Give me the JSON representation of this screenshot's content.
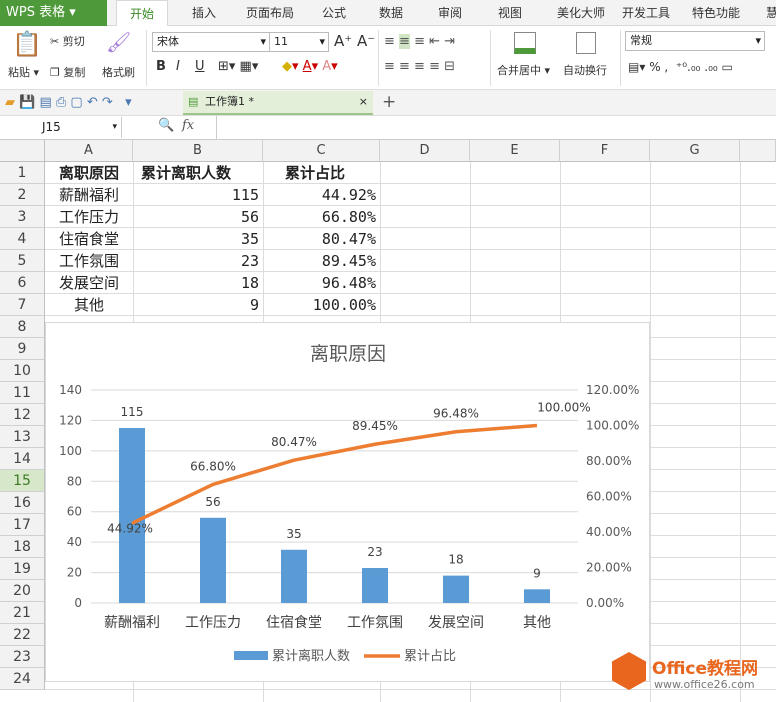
{
  "app": {
    "logo": "WPS 表格",
    "tabs": [
      "开始",
      "插入",
      "页面布局",
      "公式",
      "数据",
      "审阅",
      "视图",
      "美化大师",
      "开发工具",
      "特色功能",
      "慧"
    ]
  },
  "ribbon": {
    "paste": "粘贴",
    "cut": "剪切",
    "copy": "复制",
    "format_painter": "格式刷",
    "font_name": "宋体",
    "font_size": "11",
    "bold": "B",
    "italic": "I",
    "underline": "U",
    "merge_center": "合并居中",
    "wrap_text": "自动换行",
    "number_format": "常规",
    "percent": "%",
    "comma": ","
  },
  "quick": {
    "doc_tab": "工作簿1 *"
  },
  "formula_bar": {
    "name_box": "J15",
    "fx": "fx",
    "value": ""
  },
  "sheet": {
    "columns": [
      "A",
      "B",
      "C",
      "D",
      "E",
      "F",
      "G"
    ],
    "rows": [
      "1",
      "2",
      "3",
      "4",
      "5",
      "6",
      "7",
      "8",
      "9",
      "10",
      "11",
      "12",
      "13",
      "14",
      "15",
      "16",
      "17",
      "18",
      "19",
      "20",
      "21",
      "22",
      "23",
      "24"
    ],
    "selected_row": "15",
    "headers": [
      "离职原因",
      "累计离职人数",
      "累计占比"
    ],
    "data": [
      [
        "薪酬福利",
        "115",
        "44.92%"
      ],
      [
        "工作压力",
        "56",
        "66.80%"
      ],
      [
        "住宿食堂",
        "35",
        "80.47%"
      ],
      [
        "工作氛围",
        "23",
        "89.45%"
      ],
      [
        "发展空间",
        "18",
        "96.48%"
      ],
      [
        "其他",
        "9",
        "100.00%"
      ]
    ]
  },
  "chart_data": {
    "type": "bar+line",
    "title": "离职原因",
    "categories": [
      "薪酬福利",
      "工作压力",
      "住宿食堂",
      "工作氛围",
      "发展空间",
      "其他"
    ],
    "series": [
      {
        "name": "累计离职人数",
        "type": "bar",
        "axis": "left",
        "color": "#5b9bd5",
        "values": [
          115,
          56,
          35,
          23,
          18,
          9
        ],
        "labels": [
          "115",
          "56",
          "35",
          "23",
          "18",
          "9"
        ]
      },
      {
        "name": "累计占比",
        "type": "line",
        "axis": "right",
        "color": "#ed7d31",
        "values": [
          44.92,
          66.8,
          80.47,
          89.45,
          96.48,
          100.0
        ],
        "labels": [
          "44.92%",
          "66.80%",
          "80.47%",
          "89.45%",
          "96.48%",
          "100.00%"
        ]
      }
    ],
    "ylim_left": [
      0,
      140
    ],
    "yticks_left": [
      "0",
      "20",
      "40",
      "60",
      "80",
      "100",
      "120",
      "140"
    ],
    "ylim_right": [
      0,
      120
    ],
    "yticks_right": [
      "0.00%",
      "20.00%",
      "40.00%",
      "60.00%",
      "80.00%",
      "100.00%",
      "120.00%"
    ],
    "grid": true,
    "legend": "bottom"
  },
  "watermark": {
    "name": "Office教程网",
    "url": "www.office26.com"
  }
}
